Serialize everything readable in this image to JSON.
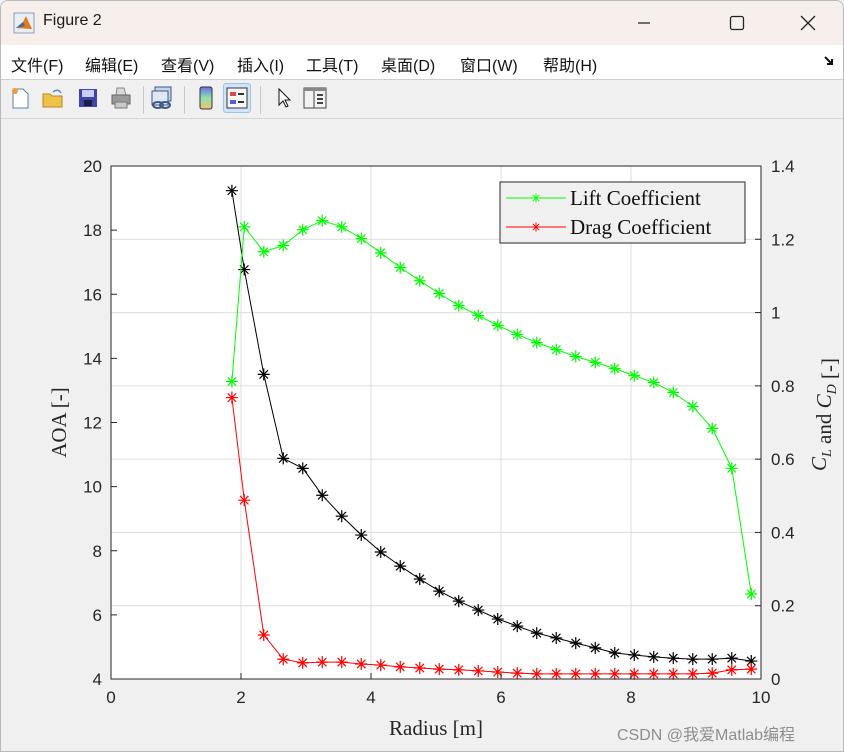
{
  "window": {
    "title": "Figure 2",
    "controls": {
      "minimize": "—",
      "maximize": "☐",
      "close": "✕"
    }
  },
  "menubar": {
    "items": [
      {
        "label": "文件(F)"
      },
      {
        "label": "编辑(E)"
      },
      {
        "label": "查看(V)"
      },
      {
        "label": "插入(I)"
      },
      {
        "label": "工具(T)"
      },
      {
        "label": "桌面(D)"
      },
      {
        "label": "窗口(W)"
      },
      {
        "label": "帮助(H)"
      }
    ],
    "dock_icon": "dock-arrow-icon"
  },
  "toolbar": {
    "buttons": [
      {
        "name": "new-figure",
        "icon": "new-file-icon"
      },
      {
        "name": "open-file",
        "icon": "folder-open-icon"
      },
      {
        "name": "save",
        "icon": "floppy-disk-icon"
      },
      {
        "name": "print",
        "icon": "printer-icon"
      },
      {
        "name": "link-plot",
        "icon": "link-plot-icon"
      },
      {
        "name": "colorbar",
        "icon": "colorbar-icon"
      },
      {
        "name": "legend",
        "icon": "legend-icon",
        "active": true
      },
      {
        "name": "edit-plot",
        "icon": "pointer-arrow-icon"
      },
      {
        "name": "property-inspector",
        "icon": "property-panel-icon"
      }
    ]
  },
  "watermark": "CSDN @我爱Matlab编程",
  "chart_data": {
    "type": "line",
    "title": "",
    "xlabel": "Radius [m]",
    "ylabel_left": "AOA [-]",
    "ylabel_right": "C_L and C_D [-]",
    "xlim": [
      0,
      10
    ],
    "ylim_left": [
      4,
      20
    ],
    "ylim_right": [
      0,
      1.4
    ],
    "xticks": [
      0,
      2,
      4,
      6,
      8,
      10
    ],
    "yticks_left": [
      4,
      6,
      8,
      10,
      12,
      14,
      16,
      18,
      20
    ],
    "yticks_right": [
      0,
      0.2,
      0.4,
      0.6,
      0.8,
      1,
      1.2,
      1.4
    ],
    "ytick_labels_right": [
      "0",
      "0.2",
      "0.4",
      "0.6",
      "0.8",
      "1",
      "1.2",
      "1.4"
    ],
    "grid": true,
    "legend_position": "top-right",
    "x": [
      1.86,
      2.05,
      2.35,
      2.65,
      2.95,
      3.25,
      3.55,
      3.85,
      4.15,
      4.45,
      4.75,
      5.05,
      5.35,
      5.65,
      5.95,
      6.25,
      6.55,
      6.85,
      7.15,
      7.45,
      7.75,
      8.05,
      8.35,
      8.65,
      8.95,
      9.25,
      9.55,
      9.85
    ],
    "series": [
      {
        "name": "AOA",
        "axis": "left",
        "color": "#000000",
        "marker": "*",
        "in_legend": false,
        "values": [
          19.23,
          16.77,
          13.5,
          10.88,
          10.57,
          9.73,
          9.08,
          8.49,
          7.96,
          7.52,
          7.12,
          6.74,
          6.43,
          6.15,
          5.87,
          5.65,
          5.43,
          5.28,
          5.12,
          4.97,
          4.81,
          4.75,
          4.69,
          4.65,
          4.62,
          4.62,
          4.65,
          4.56
        ]
      },
      {
        "name": "Lift Coefficient",
        "axis": "right",
        "color": "#00ff00",
        "marker": "*",
        "in_legend": true,
        "values": [
          0.812,
          1.234,
          1.166,
          1.183,
          1.226,
          1.251,
          1.234,
          1.202,
          1.163,
          1.123,
          1.087,
          1.052,
          1.019,
          0.992,
          0.965,
          0.94,
          0.918,
          0.899,
          0.88,
          0.864,
          0.847,
          0.828,
          0.809,
          0.782,
          0.744,
          0.684,
          0.575,
          0.232
        ]
      },
      {
        "name": "Drag Coefficient",
        "axis": "right",
        "color": "#ff0000",
        "marker": "*",
        "in_legend": true,
        "values": [
          0.768,
          0.488,
          0.12,
          0.054,
          0.044,
          0.046,
          0.046,
          0.041,
          0.038,
          0.033,
          0.03,
          0.027,
          0.025,
          0.022,
          0.019,
          0.016,
          0.014,
          0.014,
          0.014,
          0.014,
          0.014,
          0.014,
          0.014,
          0.014,
          0.014,
          0.016,
          0.025,
          0.027
        ]
      }
    ]
  }
}
